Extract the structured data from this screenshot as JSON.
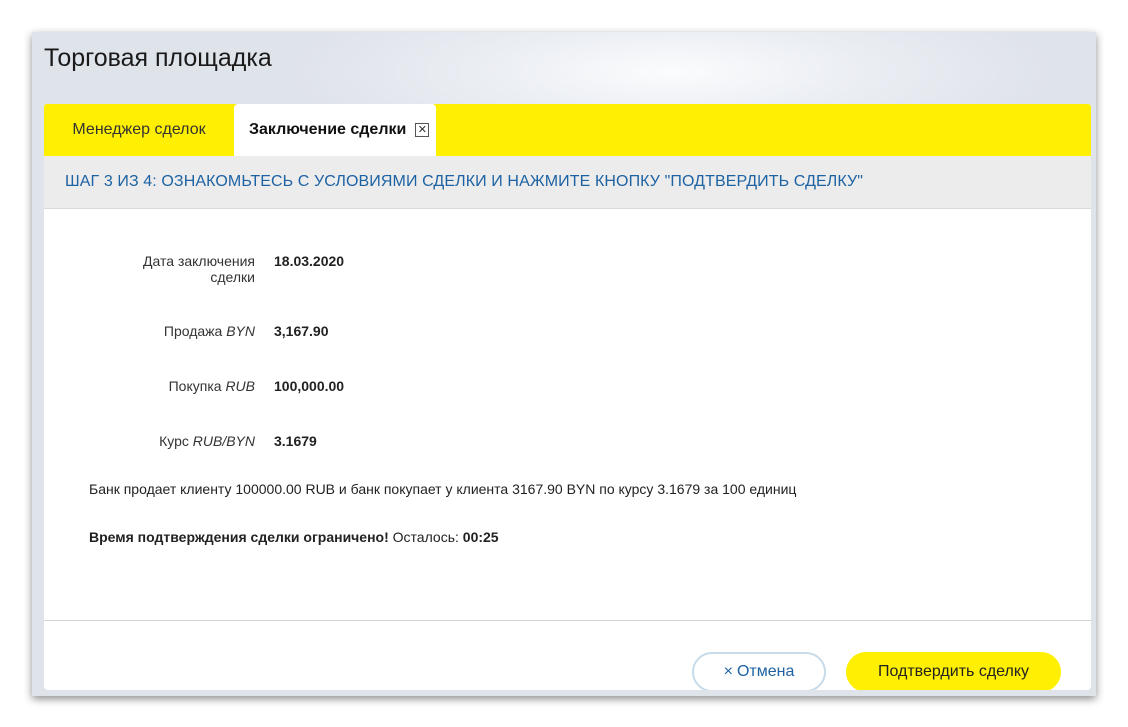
{
  "window": {
    "title": "Торговая площадка"
  },
  "tabs": [
    {
      "label": "Менеджер сделок",
      "active": false
    },
    {
      "label": "Заключение сделки",
      "active": true,
      "close_icon": "close-box-icon"
    }
  ],
  "step": {
    "title": "ШАГ 3 ИЗ 4: ОЗНАКОМЬТЕСЬ С УСЛОВИЯМИ СДЕЛКИ И НАЖМИТЕ КНОПКУ \"ПОДТВЕРДИТЬ СДЕЛКУ\""
  },
  "deal": {
    "date": {
      "label_line1": "Дата заключения",
      "label_line2": "сделки",
      "value": "18.03.2020"
    },
    "sell": {
      "label": "Продажа",
      "currency": "BYN",
      "value": "3,167.90"
    },
    "buy": {
      "label": "Покупка",
      "currency": "RUB",
      "value": "100,000.00"
    },
    "rate": {
      "label": "Курс",
      "pair": "RUB/BYN",
      "value": "3.1679"
    }
  },
  "summary": "Банк продает клиенту 100000.00 RUB и банк покупает у клиента 3167.90 BYN по курсу 3.1679 за 100 единиц",
  "timer": {
    "warning": "Время подтверждения сделки ограничено!",
    "remaining_label": "Осталось:",
    "remaining_value": "00:25"
  },
  "buttons": {
    "cancel_icon": "×",
    "cancel_label": "Отмена",
    "confirm_label": "Подтвердить сделку"
  },
  "colors": {
    "accent_yellow": "#ffef00",
    "link_blue": "#1d62a3"
  }
}
